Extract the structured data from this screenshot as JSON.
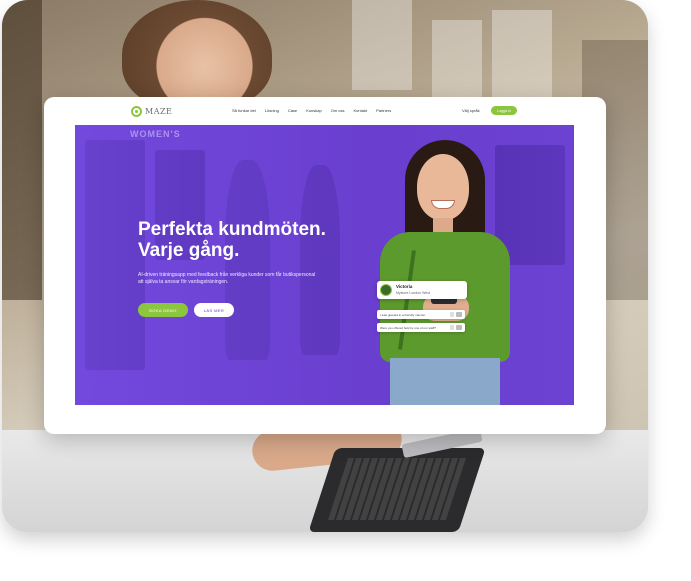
{
  "nav": {
    "logo_text": "MAZE",
    "links": [
      "Så funkar det",
      "Lösning",
      "Case",
      "Kunskap",
      "Om oss",
      "Kontakt",
      "Partners"
    ],
    "language": "Välj språk",
    "cta_label": "Logga in"
  },
  "hero": {
    "store_sign": "WOMEN'S",
    "headline_line1": "Perfekta kundmöten.",
    "headline_line2": "Varje gång.",
    "subtext": "AI-driven träningsapp med feedback från verkliga kunder som får butikspersonal att själva ta ansvar för vardagsträningen.",
    "primary_button": "BOKA DEMO",
    "secondary_button": "LÄS MER"
  },
  "profile_card": {
    "name": "Victoria",
    "subtitle": "Mystore London West"
  },
  "feedback": [
    {
      "text": "I was greeted in a friendly manner."
    },
    {
      "text": "Were you offered help by one of our staff?"
    }
  ],
  "colors": {
    "brand_purple": "#6a3fd0",
    "brand_green": "#8cc63f"
  },
  "icons": {
    "logo": "maze-logo-icon",
    "thumb": "thumbs-up-icon"
  }
}
